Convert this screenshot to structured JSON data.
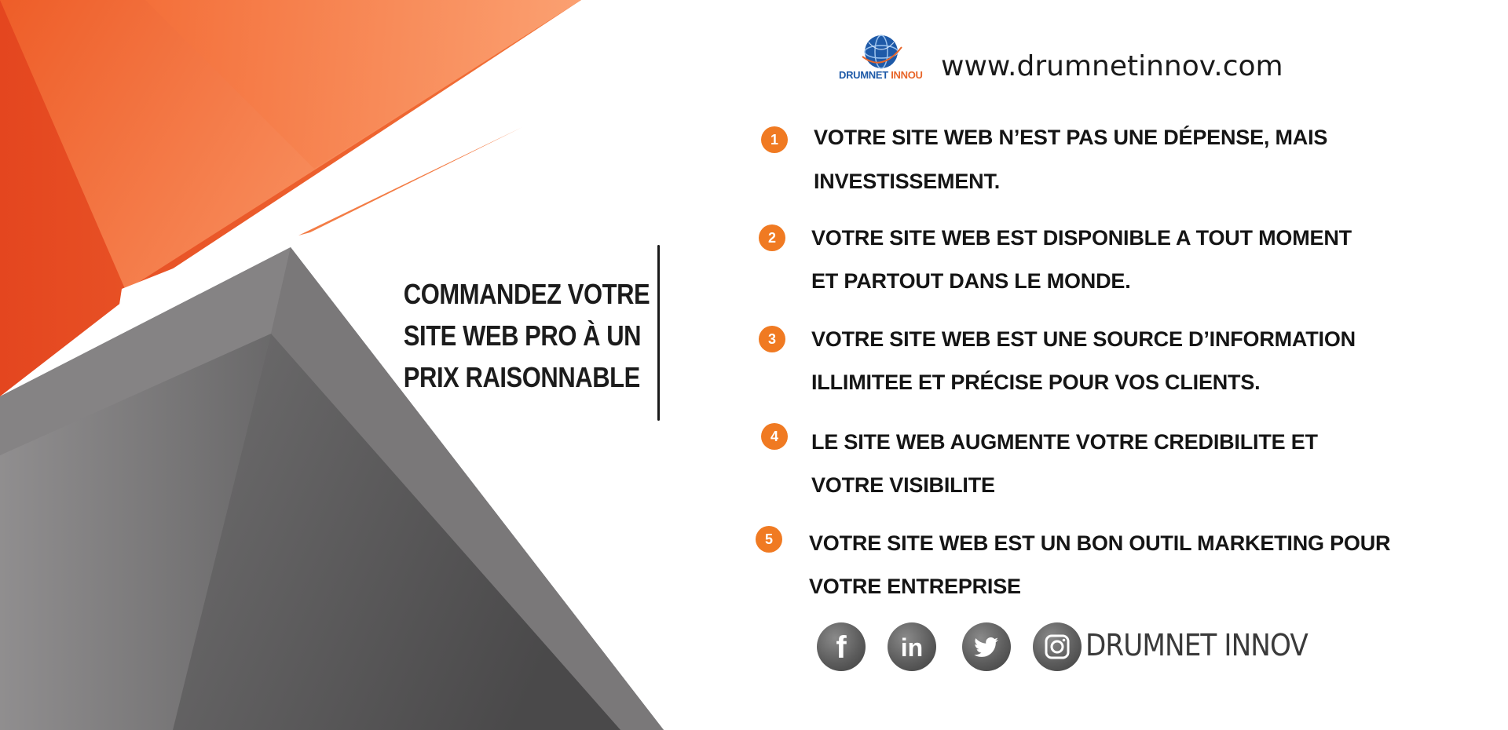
{
  "header": {
    "logo_text_main": "DRUMNET",
    "logo_text_accent": "INNOU",
    "website": "www.drumnetinnov.com"
  },
  "headline": {
    "lines": [
      "COMMANDEZ VOTRE",
      "SITE WEB PRO À UN",
      "PRIX RAISONNABLE"
    ]
  },
  "points": [
    {
      "number": "1",
      "line1": "VOTRE  SITE WEB N’EST PAS UNE DÉPENSE, MAIS",
      "line2": "INVESTISSEMENT."
    },
    {
      "number": "2",
      "line1": "VOTRE  SITE WEB EST DISPONIBLE A TOUT MOMENT",
      "line2": "ET PARTOUT DANS LE MONDE."
    },
    {
      "number": "3",
      "line1": "VOTRE  SITE WEB EST UNE SOURCE D’INFORMATION",
      "line2": "ILLIMITEE ET  PRÉCISE POUR VOS CLIENTS."
    },
    {
      "number": "4",
      "line1": "LE SITE WEB AUGMENTE VOTRE CREDIBILITE ET",
      "line2": "VOTRE VISIBILITE"
    },
    {
      "number": "5",
      "line1": "VOTRE  SITE WEB EST UN BON OUTIL MARKETING POUR",
      "line2": "VOTRE ENTREPRISE"
    }
  ],
  "footer": {
    "social_icons": [
      "facebook-icon",
      "linkedin-icon",
      "twitter-icon",
      "instagram-icon"
    ],
    "linkedin_text": "in",
    "facebook_text": "f",
    "brand": "DRUMNET INNOV"
  },
  "colors": {
    "orange": "#f07a22",
    "orange_dark": "#e8512a",
    "gray_dark": "#4e4d4e",
    "logo_blue": "#1e5aa8"
  }
}
